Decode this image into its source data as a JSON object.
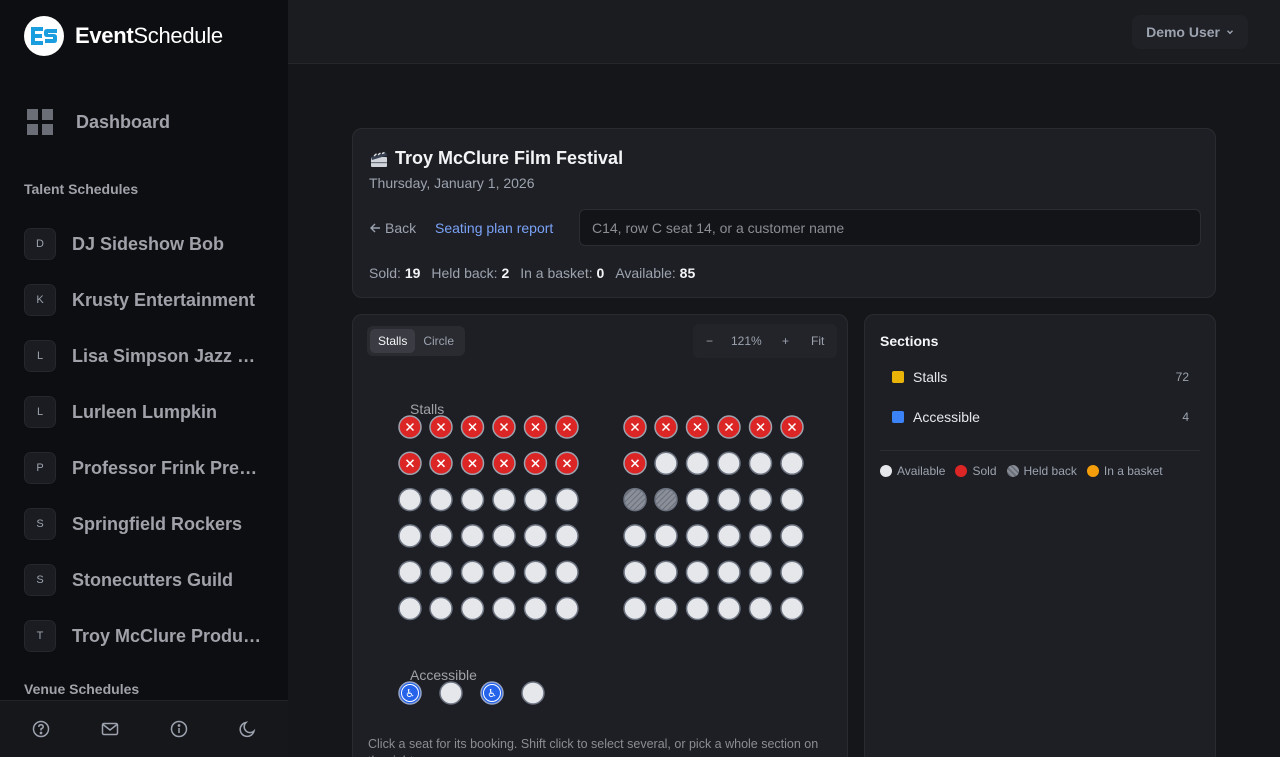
{
  "app": {
    "logo_bold": "Event",
    "logo_regular": "Schedule"
  },
  "nav": {
    "dashboard_label": "Dashboard"
  },
  "sidebar": {
    "talent_title": "Talent Schedules",
    "talent_items": [
      {
        "initial": "D",
        "name": "DJ Sideshow Bob"
      },
      {
        "initial": "K",
        "name": "Krusty Entertainment"
      },
      {
        "initial": "L",
        "name": "Lisa Simpson Jazz Quartet"
      },
      {
        "initial": "L",
        "name": "Lurleen Lumpkin"
      },
      {
        "initial": "P",
        "name": "Professor Frink Presents"
      },
      {
        "initial": "S",
        "name": "Springfield Rockers"
      },
      {
        "initial": "S",
        "name": "Stonecutters Guild"
      },
      {
        "initial": "T",
        "name": "Troy McClure Productions"
      }
    ],
    "venue_title": "Venue Schedules",
    "footer_icons": [
      "help-icon",
      "mail-icon",
      "info-icon",
      "moon-icon"
    ]
  },
  "header": {
    "user_label": "Demo User"
  },
  "event": {
    "icon": "clapperboard-icon",
    "title": "Troy McClure Film Festival",
    "date": "Thursday, January 1, 2026",
    "back_label": "Back",
    "report_label": "Seating plan report",
    "search_placeholder": "C14, row C seat 14, or a customer name",
    "stats": {
      "sold_label": "Sold:",
      "sold": "19",
      "held_label": "Held back:",
      "held": "2",
      "basket_label": "In a basket:",
      "basket": "0",
      "available_label": "Available:",
      "available": "85"
    }
  },
  "map": {
    "tabs": [
      "Stalls",
      "Circle"
    ],
    "active_tab": "Stalls",
    "zoom_minus": "−",
    "zoom_level": "121%",
    "zoom_plus": "+",
    "fit_label": "Fit",
    "stalls_label": "Stalls",
    "accessible_label": "Accessible",
    "stalls_rows": [
      [
        "sold",
        "sold",
        "sold",
        "sold",
        "sold",
        "sold",
        "sold",
        "sold",
        "sold",
        "sold",
        "sold",
        "sold"
      ],
      [
        "sold",
        "sold",
        "sold",
        "sold",
        "sold",
        "sold",
        "sold",
        "available",
        "available",
        "available",
        "available",
        "available"
      ],
      [
        "available",
        "available",
        "available",
        "available",
        "available",
        "available",
        "held",
        "held",
        "available",
        "available",
        "available",
        "available"
      ],
      [
        "available",
        "available",
        "available",
        "available",
        "available",
        "available",
        "available",
        "available",
        "available",
        "available",
        "available",
        "available"
      ],
      [
        "available",
        "available",
        "available",
        "available",
        "available",
        "available",
        "available",
        "available",
        "available",
        "available",
        "available",
        "available"
      ],
      [
        "available",
        "available",
        "available",
        "available",
        "available",
        "available",
        "available",
        "available",
        "available",
        "available",
        "available",
        "available"
      ]
    ],
    "accessible_row": [
      "sold-wheelchair",
      "available",
      "sold-wheelchair",
      "available"
    ],
    "hint": "Click a seat for its booking. Shift click to select several, or pick a whole section on the right."
  },
  "sections": {
    "title": "Sections",
    "items": [
      {
        "name": "Stalls",
        "count": "72",
        "color": "#eab308"
      },
      {
        "name": "Accessible",
        "count": "4",
        "color": "#3b82f6"
      }
    ],
    "legend": [
      {
        "label": "Available",
        "color": "#e5e7eb"
      },
      {
        "label": "Sold",
        "color": "#dc2626"
      },
      {
        "label": "Held back",
        "color": "#8b8f99"
      },
      {
        "label": "In a basket",
        "color": "#f59e0b"
      }
    ]
  },
  "colors": {
    "accent": "#7aa2f7",
    "sold": "#dc2626",
    "available": "#e5e7eb",
    "held": "#8b8f99",
    "accessible": "#2563eb"
  }
}
